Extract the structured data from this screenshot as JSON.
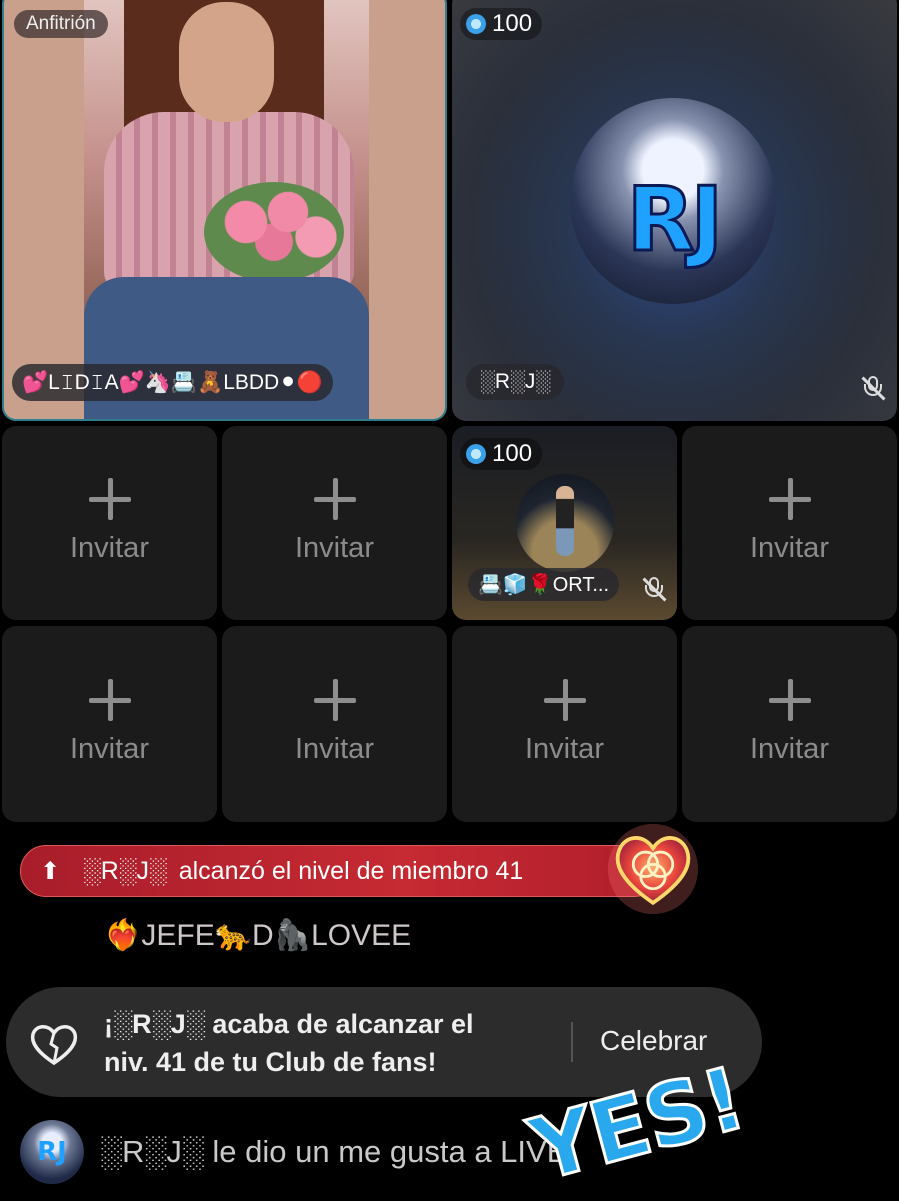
{
  "host": {
    "badge": "Anfitrión",
    "name": "💕L𝙸D𝙸A💕🦄📇🧸LBDD⚫🔴"
  },
  "guest_rj": {
    "coins": "100",
    "name": "░R░J░",
    "avatar_text": "RJ"
  },
  "guest_ort": {
    "coins": "100",
    "name": "📇🧊🌹ORT..."
  },
  "invite": {
    "label": "Invitar"
  },
  "level_notice": {
    "user": "░R░J░",
    "text": "alcanzó el nivel de miembro 41"
  },
  "fan_name": "❤️‍🔥JEFE🐆D🦍LOVEE",
  "club_notice": {
    "line1": "¡░R░J░ acaba de alcanzar el",
    "line2": "niv. 41 de tu Club de fans!",
    "button": "Celebrar"
  },
  "like_message": {
    "avatar_text": "RJ",
    "text": "░R░J░ le dio un me gusta a LIVE"
  },
  "sticker": "YES!",
  "colors": {
    "notice_red": "#c62a33",
    "host_border": "#2f7d8c",
    "sticker_blue": "#2aa8ee"
  },
  "icons": [
    "plus-icon",
    "coin-icon",
    "mic-off-icon",
    "arrow-up-icon",
    "heart-badge-icon",
    "heart-outline-icon"
  ]
}
